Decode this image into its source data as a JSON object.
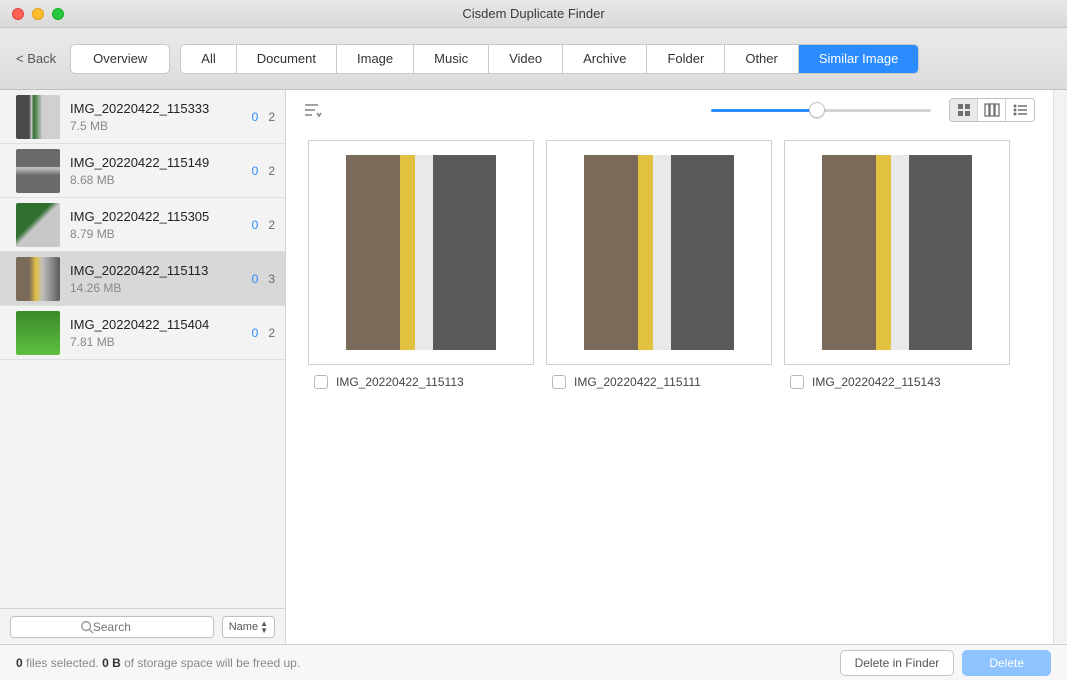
{
  "window": {
    "title": "Cisdem Duplicate Finder"
  },
  "toolbar": {
    "back_label": "< Back",
    "overview_label": "Overview",
    "tabs": [
      "All",
      "Document",
      "Image",
      "Music",
      "Video",
      "Archive",
      "Folder",
      "Other",
      "Similar Image"
    ],
    "active_tab_index": 8
  },
  "sidebar": {
    "items": [
      {
        "name": "IMG_20220422_115333",
        "size": "7.5 MB",
        "selected_dup_count": "0",
        "total_count": "2",
        "selected": false
      },
      {
        "name": "IMG_20220422_115149",
        "size": "8.68 MB",
        "selected_dup_count": "0",
        "total_count": "2",
        "selected": false
      },
      {
        "name": "IMG_20220422_115305",
        "size": "8.79 MB",
        "selected_dup_count": "0",
        "total_count": "2",
        "selected": false
      },
      {
        "name": "IMG_20220422_115113",
        "size": "14.26 MB",
        "selected_dup_count": "0",
        "total_count": "3",
        "selected": true
      },
      {
        "name": "IMG_20220422_115404",
        "size": "7.81 MB",
        "selected_dup_count": "0",
        "total_count": "2",
        "selected": false
      }
    ],
    "search_placeholder": "Search",
    "sort_label": "Name"
  },
  "content": {
    "slider_percent": 48,
    "active_view_index": 0,
    "images": [
      {
        "name": "IMG_20220422_115113",
        "checked": false
      },
      {
        "name": "IMG_20220422_115111",
        "checked": false
      },
      {
        "name": "IMG_20220422_115143",
        "checked": false
      }
    ]
  },
  "footer": {
    "files_selected_count": "0",
    "files_selected_suffix": " files selected. ",
    "storage_freed": "0 B",
    "storage_freed_suffix": " of storage space will be freed up.",
    "delete_in_finder_label": "Delete in Finder",
    "delete_label": "Delete"
  }
}
